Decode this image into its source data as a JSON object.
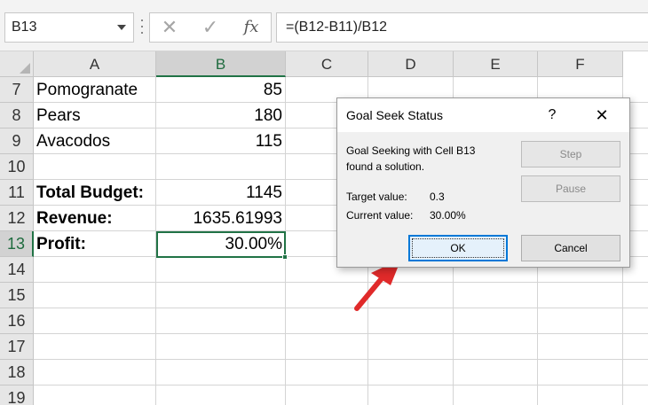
{
  "formula_bar": {
    "name_box": "B13",
    "cancel_glyph": "✕",
    "enter_glyph": "✓",
    "fx_label": "fx",
    "formula": "=(B12-B11)/B12"
  },
  "columns": [
    "A",
    "B",
    "C",
    "D",
    "E",
    "F"
  ],
  "selected_column": "B",
  "rows": [
    {
      "num": "7",
      "a": "Pomogranate",
      "b": "85",
      "bold": false
    },
    {
      "num": "8",
      "a": "Pears",
      "b": "180",
      "bold": false
    },
    {
      "num": "9",
      "a": "Avacodos",
      "b": "115",
      "bold": false
    },
    {
      "num": "10",
      "a": "",
      "b": "",
      "bold": false
    },
    {
      "num": "11",
      "a": "Total Budget:",
      "b": "1145",
      "bold": true
    },
    {
      "num": "12",
      "a": "Revenue:",
      "b": "1635.61993",
      "bold": true
    },
    {
      "num": "13",
      "a": "Profit:",
      "b": "30.00%",
      "bold": true
    },
    {
      "num": "14",
      "a": "",
      "b": "",
      "bold": false
    },
    {
      "num": "15",
      "a": "",
      "b": "",
      "bold": false
    },
    {
      "num": "16",
      "a": "",
      "b": "",
      "bold": false
    },
    {
      "num": "17",
      "a": "",
      "b": "",
      "bold": false
    },
    {
      "num": "18",
      "a": "",
      "b": "",
      "bold": false
    },
    {
      "num": "19",
      "a": "",
      "b": "",
      "bold": false
    }
  ],
  "selected_row": "13",
  "dialog": {
    "title": "Goal Seek Status",
    "help": "?",
    "close": "✕",
    "message_line1": "Goal Seeking with Cell B13",
    "message_line2": "found a solution.",
    "target_label": "Target value:",
    "target_value": "0.3",
    "current_label": "Current value:",
    "current_value": "30.00%",
    "step_label": "Step",
    "pause_label": "Pause",
    "ok_label": "OK",
    "cancel_label": "Cancel"
  },
  "colors": {
    "accent_green": "#217346",
    "arrow_red": "#e02a2a",
    "dialog_focus_blue": "#0078d7"
  },
  "annotation_arrow": "red-arrow-pointing-to-ok"
}
